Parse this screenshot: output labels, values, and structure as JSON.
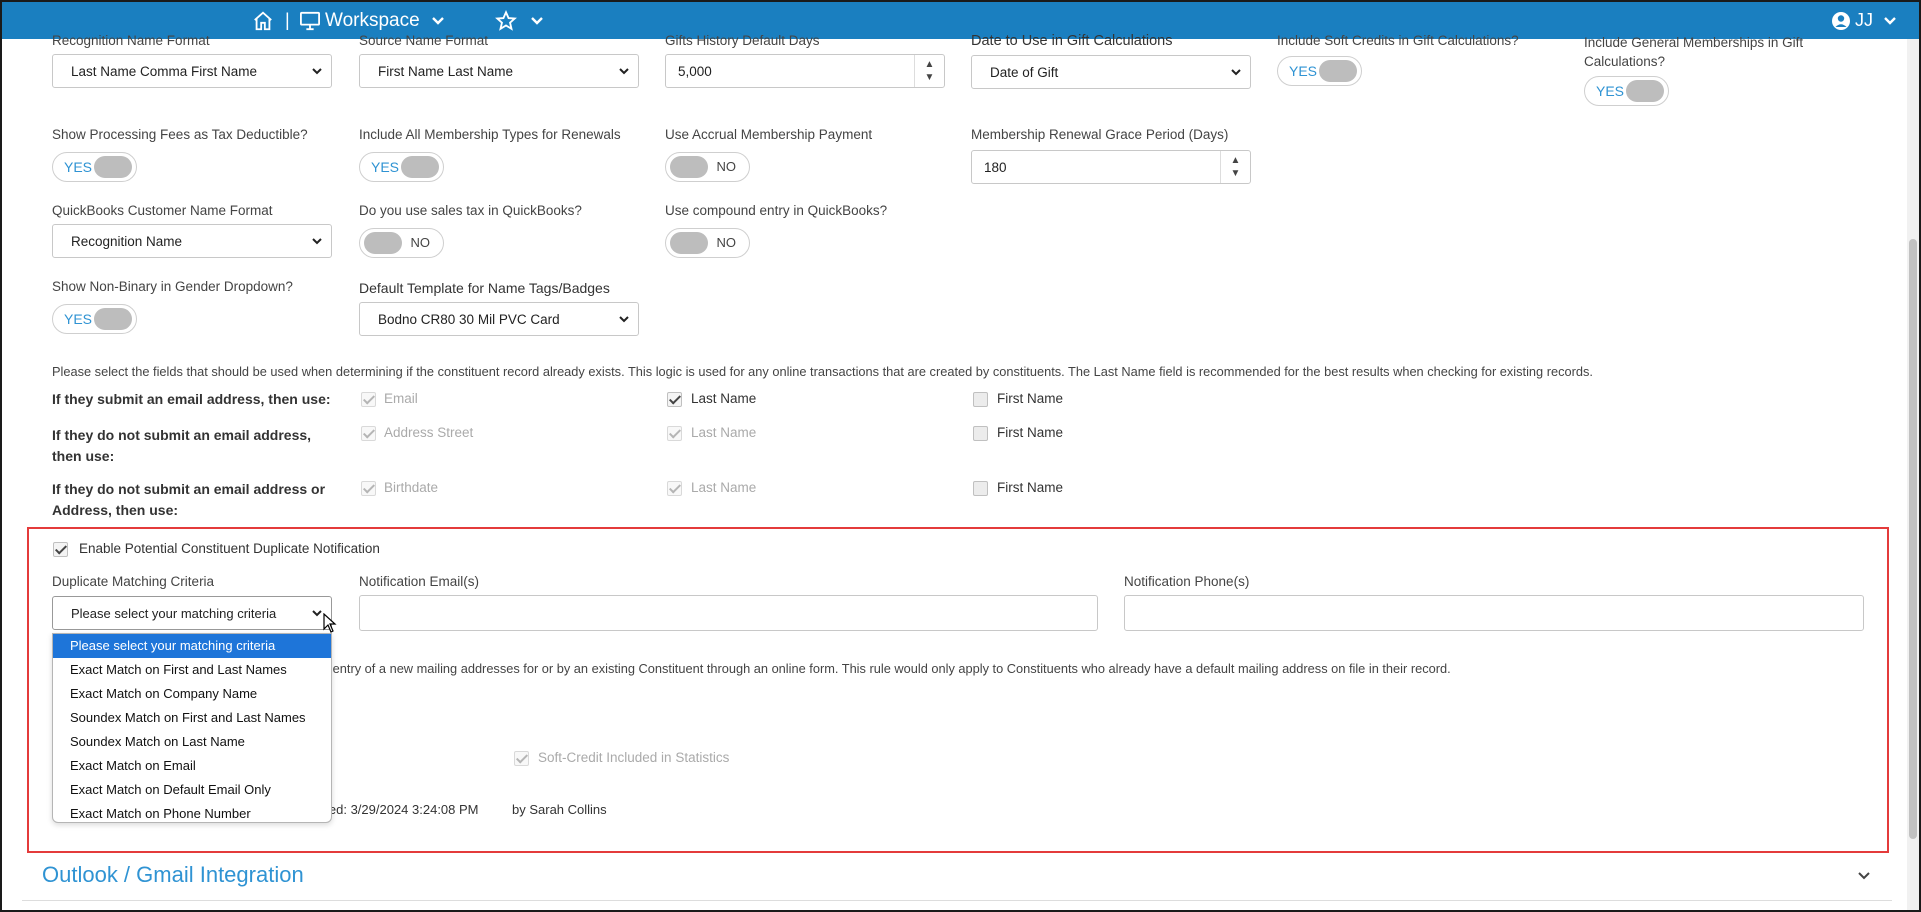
{
  "topbar": {
    "workspace_label": "Workspace",
    "user_initials": "JJ",
    "separator": "|"
  },
  "row1": {
    "recognition_label": "Recognition Name Format",
    "recognition_value": "Last Name Comma First Name",
    "source_label": "Source Name Format",
    "source_value": "First Name Last Name",
    "gifts_history_label": "Gifts History Default Days",
    "gifts_history_value": "5,000",
    "date_gift_label": "Date to Use in Gift Calculations",
    "date_gift_value": "Date of Gift",
    "soft_credits_label": "Include Soft Credits in Gift Calculations?",
    "soft_credits_toggle": "YES",
    "general_memberships_label": "Include General Memberships in Gift Calculations?",
    "general_memberships_toggle": "YES"
  },
  "row2": {
    "processing_fees_label": "Show Processing Fees as Tax Deductible?",
    "processing_fees_toggle": "YES",
    "membership_types_label": "Include All Membership Types for Renewals",
    "membership_types_toggle": "YES",
    "accrual_label": "Use Accrual Membership Payment",
    "accrual_toggle": "NO",
    "grace_label": "Membership Renewal Grace Period (Days)",
    "grace_value": "180"
  },
  "row3": {
    "qb_name_label": "QuickBooks Customer Name Format",
    "qb_name_value": "Recognition Name",
    "sales_tax_label": "Do you use sales tax in QuickBooks?",
    "sales_tax_toggle": "NO",
    "compound_label": "Use compound entry in QuickBooks?",
    "compound_toggle": "NO"
  },
  "row4": {
    "nonbinary_label": "Show Non-Binary in Gender Dropdown?",
    "nonbinary_toggle": "YES",
    "template_label": "Default Template for Name Tags/Badges",
    "template_value": "Bodno CR80 30 Mil PVC Card"
  },
  "matching": {
    "intro": "Please select the fields that should be used when determining if the constituent record already exists. This logic is used for any online transactions that are created by constituents. The Last Name field is recommended for the best results when checking for existing records.",
    "rule1_label": "If they submit an email address, then use:",
    "rule1_a": "Email",
    "rule1_b": "Last Name",
    "rule1_c": "First Name",
    "rule2_label": "If they do not submit an email address, then use:",
    "rule2_a": "Address Street",
    "rule2_b": "Last Name",
    "rule2_c": "First Name",
    "rule3_label": "If they do not submit an email address or Address, then use:",
    "rule3_a": "Birthdate",
    "rule3_b": "Last Name",
    "rule3_c": "First Name"
  },
  "duplicate": {
    "enable_label": "Enable Potential Constituent Duplicate Notification",
    "criteria_label": "Duplicate Matching Criteria",
    "criteria_value": "Please select your matching criteria",
    "email_label": "Notification Email(s)",
    "phone_label": "Notification Phone(s)",
    "address_note": "e entry of a new mailing addresses for or by an existing Constituent through an online form. This rule would only apply to Constituents who already have a default mailing address on file in their record.",
    "soft_credit_label": "Soft-Credit Included in Statistics",
    "modified_text": "ied: 3/29/2024 3:24:08 PM",
    "modified_by": "by Sarah Collins",
    "options": [
      "Please select your matching criteria",
      "Exact Match on First and Last Names",
      "Exact Match on Company Name",
      "Soundex Match on First and Last Names",
      "Soundex Match on Last Name",
      "Exact Match on Email",
      "Exact Match on Default Email Only",
      "Exact Match on Phone Number"
    ]
  },
  "section": {
    "outlook_title": "Outlook / Gmail Integration"
  },
  "colors": {
    "topbar": "#1a7fc0",
    "toggle_on_text": "#2f93d3",
    "highlight": "#e43b3b",
    "selected_option": "#1e75d9",
    "section_title": "#2f93d3"
  }
}
